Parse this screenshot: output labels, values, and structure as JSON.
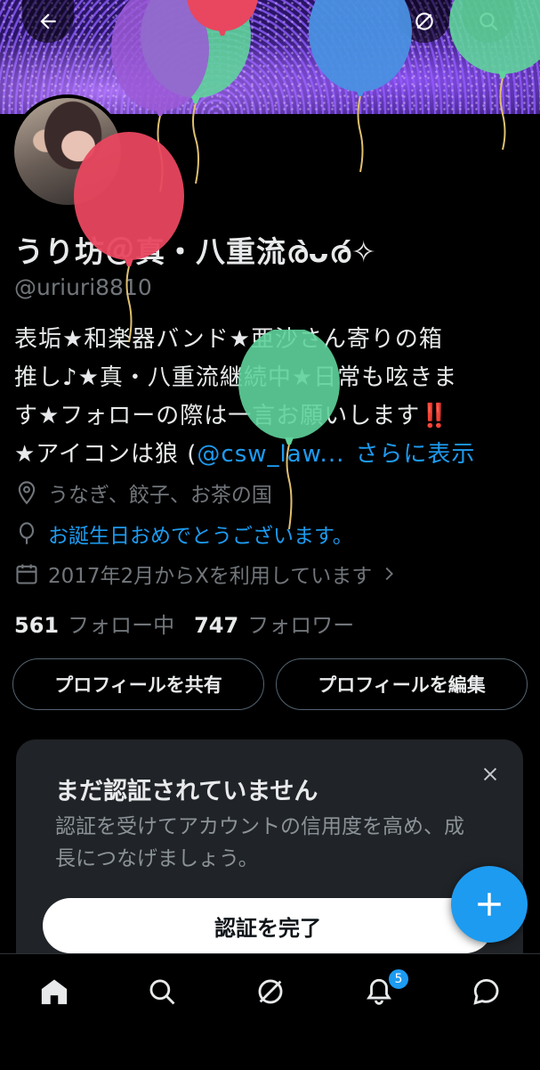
{
  "header": {
    "back_icon": "arrow-left-icon",
    "grok_icon": "grok-icon",
    "search_icon": "search-icon"
  },
  "profile": {
    "display_name": "うり坊＠真・八重流ര̀ᴗര́✧",
    "handle": "@uriuri8810",
    "bio_line1": "表垢★和楽器バンド★亜沙さん寄りの箱",
    "bio_line2": "推し♪★真・八重流継続中★日常も呟きま",
    "bio_line3": "す★フォローの際は一言お願いします‼️",
    "bio_line4_prefix": "★アイコンは狼 (",
    "bio_mention": "@csw_law...",
    "show_more": "さらに表示",
    "location": "うなぎ、餃子、お茶の国",
    "birthday": "お誕生日おめでとうございます。",
    "joined": "2017年2月からXを利用しています",
    "following_count": "561",
    "following_label": "フォロー中",
    "followers_count": "747",
    "followers_label": "フォロワー"
  },
  "actions": {
    "share_label": "プロフィールを共有",
    "edit_label": "プロフィールを編集"
  },
  "verify_card": {
    "title": "まだ認証されていません",
    "text": "認証を受けてアカウントの信用度を高め、成長につなげましょう。",
    "button_label": "認証を完了"
  },
  "nav": {
    "notification_badge": "5"
  },
  "colors": {
    "accent": "#1d9bf0",
    "muted": "#71767b",
    "balloon_pink": "#e8475f",
    "balloon_green": "#5fd39b",
    "balloon_blue": "#4a90e2",
    "balloon_purple": "#9b59d6"
  }
}
